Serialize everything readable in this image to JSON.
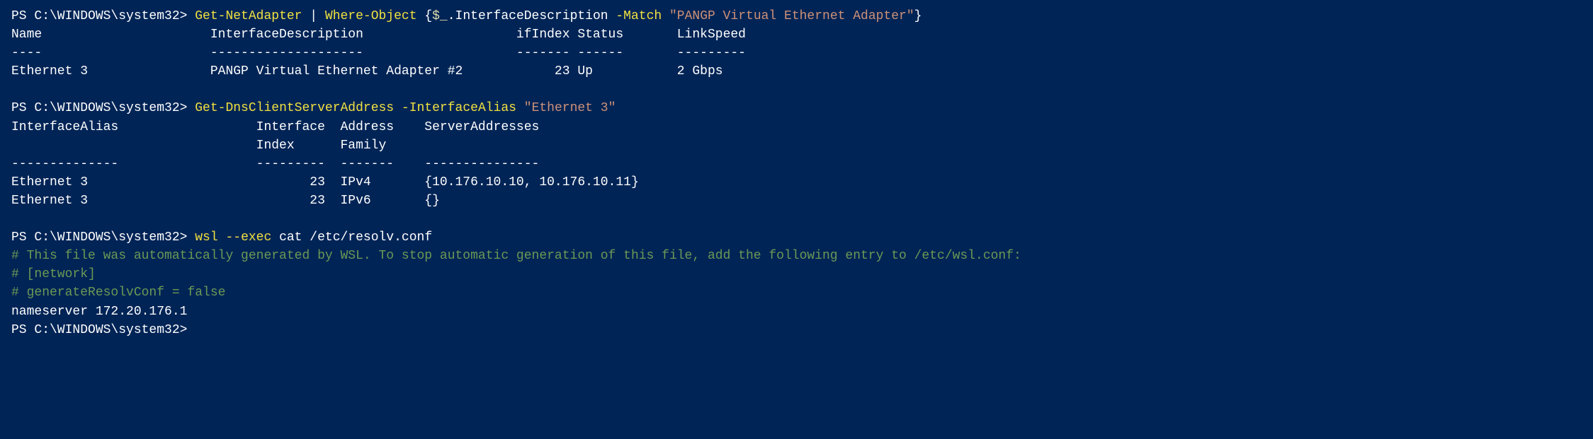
{
  "terminal": {
    "lines": [
      {
        "id": "cmd1",
        "type": "command",
        "parts": [
          {
            "text": "PS C:\\WINDOWS\\system32> ",
            "class": "prompt"
          },
          {
            "text": "Get-NetAdapter",
            "class": "cmd-yellow"
          },
          {
            "text": " | ",
            "class": "cmd-white"
          },
          {
            "text": "Where-Object",
            "class": "cmd-yellow"
          },
          {
            "text": " {",
            "class": "cmd-white"
          },
          {
            "text": "$_",
            "class": "var-yellow"
          },
          {
            "text": ".InterfaceDescription ",
            "class": "cmd-white"
          },
          {
            "text": "-Match",
            "class": "param-yellow"
          },
          {
            "text": " ",
            "class": "cmd-white"
          },
          {
            "text": "\"PANGP Virtual Ethernet Adapter\"",
            "class": "string-orange"
          },
          {
            "text": "}",
            "class": "cmd-white"
          }
        ]
      },
      {
        "id": "header1",
        "type": "output",
        "parts": [
          {
            "text": "Name                      InterfaceDescription                    ifIndex Status       LinkSpeed",
            "class": "value-white"
          }
        ]
      },
      {
        "id": "dash1",
        "type": "output",
        "parts": [
          {
            "text": "----                      --------------------                    ------- ------       ---------",
            "class": "value-white"
          }
        ]
      },
      {
        "id": "row1",
        "type": "output",
        "parts": [
          {
            "text": "Ethernet 3                PANGP Virtual Ethernet Adapter #2            23 Up           2 Gbps",
            "class": "value-white"
          }
        ]
      },
      {
        "id": "blank1",
        "type": "blank"
      },
      {
        "id": "cmd2",
        "type": "command",
        "parts": [
          {
            "text": "PS C:\\WINDOWS\\system32> ",
            "class": "prompt"
          },
          {
            "text": "Get-DnsClientServerAddress",
            "class": "cmd-yellow"
          },
          {
            "text": " ",
            "class": "cmd-white"
          },
          {
            "text": "-InterfaceAlias",
            "class": "param-yellow"
          },
          {
            "text": " ",
            "class": "cmd-white"
          },
          {
            "text": "\"Ethernet 3\"",
            "class": "string-orange"
          }
        ]
      },
      {
        "id": "header2a",
        "type": "output",
        "parts": [
          {
            "text": "InterfaceAlias                  Interface  Address    ServerAddresses",
            "class": "value-white"
          }
        ]
      },
      {
        "id": "header2b",
        "type": "output",
        "parts": [
          {
            "text": "                                Index      Family",
            "class": "value-white"
          }
        ]
      },
      {
        "id": "dash2",
        "type": "output",
        "parts": [
          {
            "text": "--------------                  ---------  -------    ---------------",
            "class": "value-white"
          }
        ]
      },
      {
        "id": "row2a",
        "type": "output",
        "parts": [
          {
            "text": "Ethernet 3                             23  IPv4       {10.176.10.10, 10.176.10.11}",
            "class": "value-white"
          }
        ]
      },
      {
        "id": "row2b",
        "type": "output",
        "parts": [
          {
            "text": "Ethernet 3                             23  IPv6       {}",
            "class": "value-white"
          }
        ]
      },
      {
        "id": "blank2",
        "type": "blank"
      },
      {
        "id": "cmd3",
        "type": "command",
        "parts": [
          {
            "text": "PS C:\\WINDOWS\\system32> ",
            "class": "prompt"
          },
          {
            "text": "wsl",
            "class": "cmd-yellow"
          },
          {
            "text": " ",
            "class": "cmd-white"
          },
          {
            "text": "--exec",
            "class": "param-yellow"
          },
          {
            "text": " cat /etc/resolv.conf",
            "class": "cmd-white"
          }
        ]
      },
      {
        "id": "comment1",
        "type": "output",
        "parts": [
          {
            "text": "# This file was automatically generated by WSL. To stop automatic generation of this file, add the following entry to /etc/wsl.conf:",
            "class": "comment"
          }
        ]
      },
      {
        "id": "comment2",
        "type": "output",
        "parts": [
          {
            "text": "# [network]",
            "class": "comment"
          }
        ]
      },
      {
        "id": "comment3",
        "type": "output",
        "parts": [
          {
            "text": "# generateResolvConf = false",
            "class": "comment"
          }
        ]
      },
      {
        "id": "nameserver",
        "type": "output",
        "parts": [
          {
            "text": "nameserver 172.20.176.1",
            "class": "value-white"
          }
        ]
      },
      {
        "id": "prompt-end",
        "type": "output",
        "parts": [
          {
            "text": "PS C:\\WINDOWS\\system32> ",
            "class": "prompt"
          }
        ]
      }
    ]
  }
}
